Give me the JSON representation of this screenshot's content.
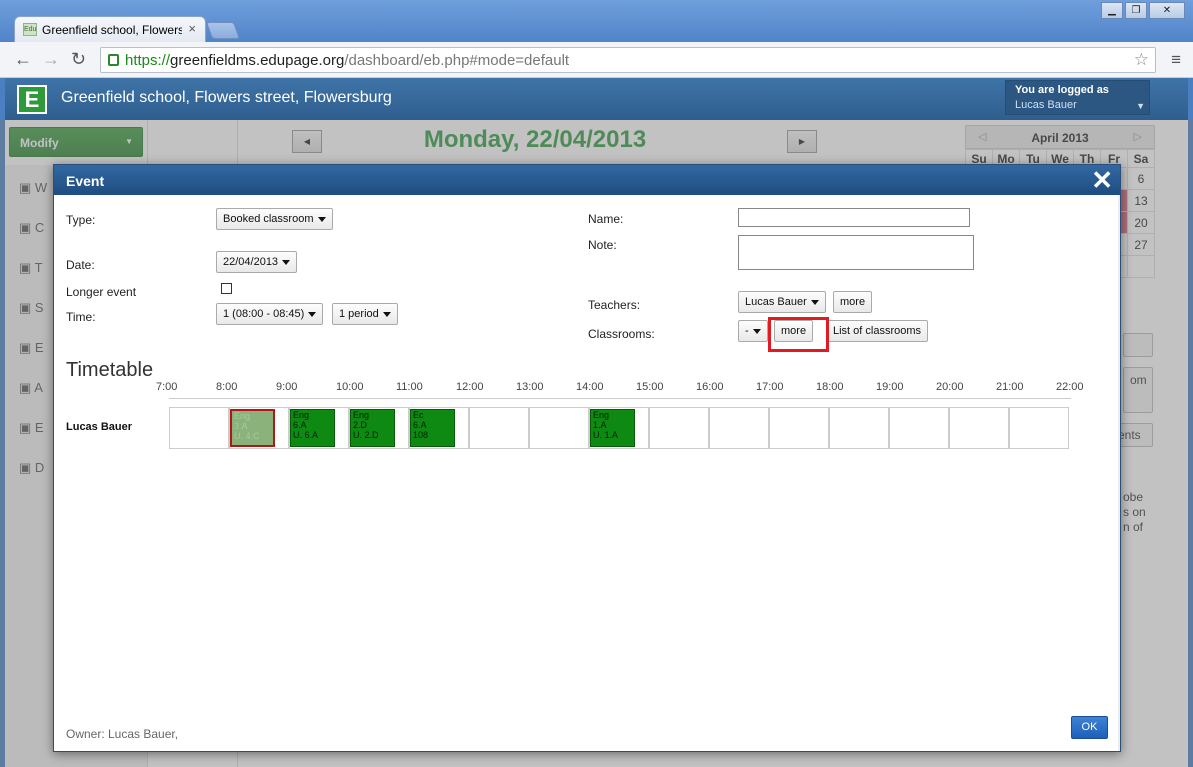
{
  "browser": {
    "tab_title": "Greenfield school, Flowers st",
    "tab_close": "×",
    "favicon_text": "Edu",
    "url_scheme": "https://",
    "url_domain": "greenfieldms.edupage.org",
    "url_path": "/dashboard/eb.php#mode=default",
    "window_buttons": [
      "▁",
      "❐",
      "✕"
    ]
  },
  "app": {
    "logo_letter": "E",
    "school_name": "Greenfield school, Flowers street, Flowersburg",
    "logged_in_label": "You are logged as",
    "user_name": "Lucas Bauer"
  },
  "background": {
    "modify_label": "Modify",
    "date_heading": "Monday, 22/04/2013",
    "calendar": {
      "month": "April 2013",
      "dow": [
        "Su",
        "Mo",
        "Tu",
        "We",
        "Th",
        "Fr",
        "Sa"
      ],
      "sa_col": [
        "6",
        "13",
        "20",
        "27"
      ]
    },
    "left_nav_initials": [
      "W",
      "C",
      "T",
      "S",
      "E",
      "A",
      "E",
      "D"
    ],
    "right_fragments": [
      "om",
      "ents",
      "obe",
      "s on",
      "n of"
    ]
  },
  "modal": {
    "title": "Event",
    "close_icon": "✕",
    "labels": {
      "type": "Type:",
      "date": "Date:",
      "longer_event": "Longer event",
      "time": "Time:",
      "name": "Name:",
      "note": "Note:",
      "teachers": "Teachers:",
      "classrooms": "Classrooms:"
    },
    "type_value": "Booked classroom",
    "date_value": "22/04/2013",
    "time_value": "1 (08:00 - 08:45)",
    "period_value": "1 period",
    "teacher_value": "Lucas Bauer",
    "teacher_more": "more",
    "classroom_value": "-",
    "classroom_more": "more",
    "classroom_list": "List of classrooms",
    "name_value": "",
    "note_value": "",
    "longer_event_checked": false,
    "timetable": {
      "title": "Timetable",
      "hours": [
        "7:00",
        "8:00",
        "9:00",
        "10:00",
        "11:00",
        "12:00",
        "13:00",
        "14:00",
        "15:00",
        "16:00",
        "17:00",
        "18:00",
        "19:00",
        "20:00",
        "21:00",
        "22:00"
      ],
      "person": "Lucas Bauer",
      "lessons": [
        {
          "lines": [
            "Eng",
            "3.A",
            "U. 4.C"
          ],
          "selected": true
        },
        {
          "lines": [
            "Eng",
            "6.A",
            "U. 6.A"
          ],
          "selected": false
        },
        {
          "lines": [
            "Eng",
            "2.D",
            "U. 2.D"
          ],
          "selected": false
        },
        {
          "lines": [
            "Ec",
            "6.A",
            "108"
          ],
          "selected": false
        },
        {
          "lines": [
            "Eng",
            "1.A",
            "U. 1.A"
          ],
          "selected": false
        }
      ]
    },
    "owner": "Owner: Lucas Bauer,",
    "ok_label": "OK"
  }
}
